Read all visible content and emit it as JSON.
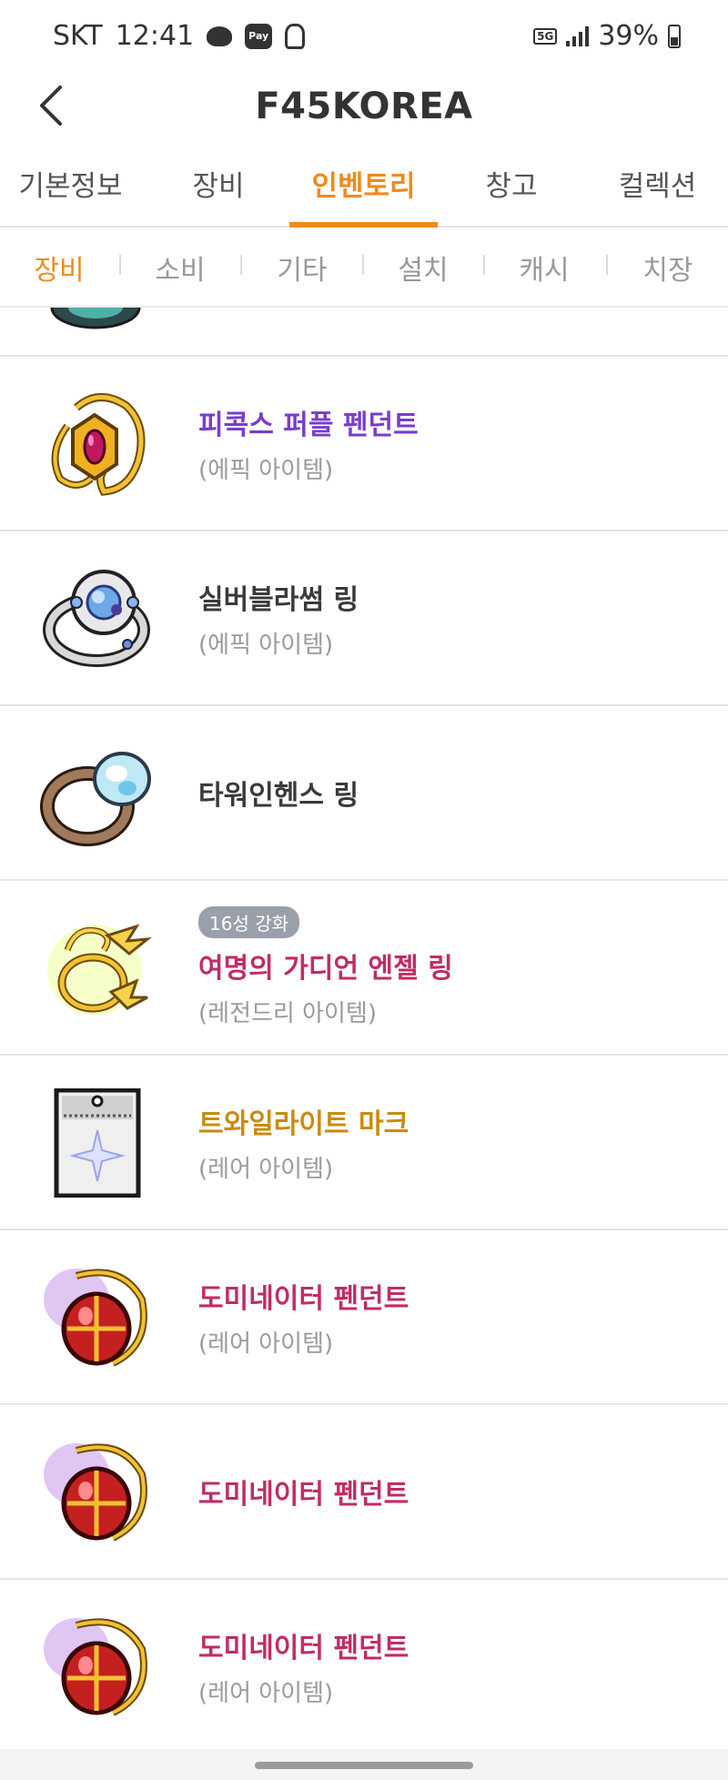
{
  "status_bar": {
    "carrier": "SKT",
    "time": "12:41",
    "pay_label": "Pay",
    "network": "5G",
    "battery": "39%"
  },
  "header": {
    "title": "F45KOREA"
  },
  "main_tabs": [
    {
      "label": "기본정보",
      "active": false
    },
    {
      "label": "장비",
      "active": false
    },
    {
      "label": "인벤토리",
      "active": true
    },
    {
      "label": "창고",
      "active": false
    },
    {
      "label": "컬렉션",
      "active": false
    }
  ],
  "sub_tabs": [
    {
      "label": "장비",
      "active": true
    },
    {
      "label": "소비",
      "active": false
    },
    {
      "label": "기타",
      "active": false
    },
    {
      "label": "설치",
      "active": false
    },
    {
      "label": "캐시",
      "active": false
    },
    {
      "label": "치장",
      "active": false
    }
  ],
  "colors": {
    "accent": "#f08a1c",
    "epic": "#7a3ccf",
    "normal": "#3a3a3a",
    "legendary": "#c02c66",
    "rare_gold": "#c98c10",
    "rare_pink": "#c02c66",
    "grade_gray": "#9a9a9a"
  },
  "items": [
    {
      "name": "피콕스 퍼플 펜던트",
      "grade": "(에픽 아이템)",
      "badge": "",
      "color": "#7a3ccf",
      "icon": "purple-pendant-icon"
    },
    {
      "name": "실버블라썸 링",
      "grade": "(에픽 아이템)",
      "badge": "",
      "color": "#3a3a3a",
      "icon": "silver-blossom-ring-icon"
    },
    {
      "name": "타워인헨스 링",
      "grade": "",
      "badge": "",
      "color": "#3a3a3a",
      "icon": "tower-enhance-ring-icon"
    },
    {
      "name": "여명의 가디언 엔젤 링",
      "grade": "(레전드리 아이템)",
      "badge": "16성 강화",
      "color": "#c02c66",
      "icon": "guardian-angel-ring-icon"
    },
    {
      "name": "트와일라이트 마크",
      "grade": "(레어 아이템)",
      "badge": "",
      "color": "#c98c10",
      "icon": "twilight-mark-icon"
    },
    {
      "name": "도미네이터 펜던트",
      "grade": "(레어 아이템)",
      "badge": "",
      "color": "#c02c66",
      "icon": "dominator-pendant-icon"
    },
    {
      "name": "도미네이터 펜던트",
      "grade": "",
      "badge": "",
      "color": "#c02c66",
      "icon": "dominator-pendant-icon"
    },
    {
      "name": "도미네이터 펜던트",
      "grade": "(레어 아이템)",
      "badge": "",
      "color": "#c02c66",
      "icon": "dominator-pendant-icon"
    }
  ]
}
